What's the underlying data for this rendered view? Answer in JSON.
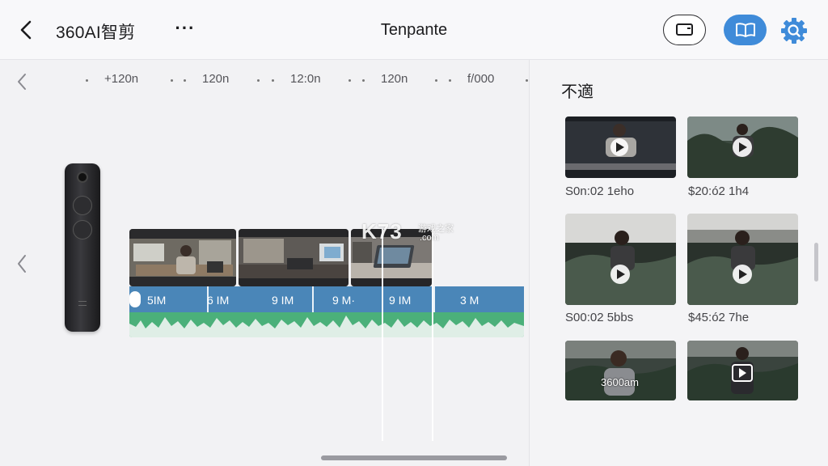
{
  "header": {
    "app_title": "360AI智剪",
    "more_label": "···",
    "doc_title": "Tenpante"
  },
  "icons": {
    "back": "chevron-left-icon",
    "more": "more-horizontal-icon",
    "screen": "screen-mirror-icon",
    "book": "book-open-icon",
    "settings": "gear-search-icon"
  },
  "ruler": {
    "labels": [
      "+120n",
      "120n",
      "12:0n",
      "120n",
      "f/000"
    ]
  },
  "timeline": {
    "segments": [
      "5IM",
      "6 IM",
      "9 IM",
      "9 M·",
      "9 IM",
      "3 M"
    ],
    "watermark": "K73",
    "watermark_sub": "游戏之家",
    "watermark_domain": ".com"
  },
  "panel": {
    "title": "不適",
    "items": [
      {
        "caption": "S0n:02 1eho"
      },
      {
        "caption": "$20:ó2 1h4"
      },
      {
        "caption": "S00:02 5bbs"
      },
      {
        "caption": "$45:ó2 7he"
      },
      {
        "caption": "",
        "overlay": "3600am"
      },
      {
        "caption": ""
      }
    ]
  },
  "colors": {
    "accent_blue": "#3f8bd9",
    "track_blue": "#4a86b8",
    "waveform_green": "#4bb07a"
  }
}
